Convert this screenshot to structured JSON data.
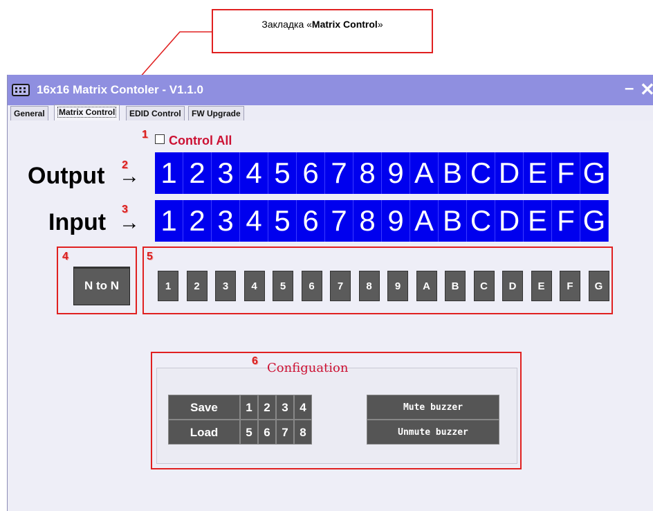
{
  "callout": {
    "prefix": "Закладка «",
    "bold": "Matrix Control",
    "suffix": "»"
  },
  "window": {
    "title": "16x16 Matrix Contoler - V1.1.0",
    "minimize": "–",
    "close": "✕"
  },
  "tabs": [
    {
      "label": "General"
    },
    {
      "label": "Matrix Control",
      "active": true
    },
    {
      "label": "EDID Control"
    },
    {
      "label": "FW Upgrade"
    }
  ],
  "control_all": {
    "label": "Control All",
    "checked": false
  },
  "output_label": "Output",
  "input_label": "Input",
  "arrow": "→",
  "channels": [
    "1",
    "2",
    "3",
    "4",
    "5",
    "6",
    "7",
    "8",
    "9",
    "A",
    "B",
    "C",
    "D",
    "E",
    "F",
    "G"
  ],
  "n_to_n_label": "N to N",
  "input_buttons": [
    "1",
    "2",
    "3",
    "4",
    "5",
    "6",
    "7",
    "8",
    "9",
    "A",
    "B",
    "C",
    "D",
    "E",
    "F",
    "G"
  ],
  "config": {
    "title": "Configuation",
    "save_label": "Save",
    "load_label": "Load",
    "save_slots": [
      "1",
      "2",
      "3",
      "4"
    ],
    "load_slots": [
      "5",
      "6",
      "7",
      "8"
    ],
    "mute_label": "Mute buzzer",
    "unmute_label": "Unmute buzzer"
  },
  "badges": [
    "1",
    "2",
    "3",
    "4",
    "5",
    "6"
  ],
  "colors": {
    "titlebar": "#8f8fe0",
    "channel_bg": "#0000ee",
    "button_bg": "#5b5b5b",
    "annotation_red": "#e02020",
    "label_red": "#cc1133"
  }
}
